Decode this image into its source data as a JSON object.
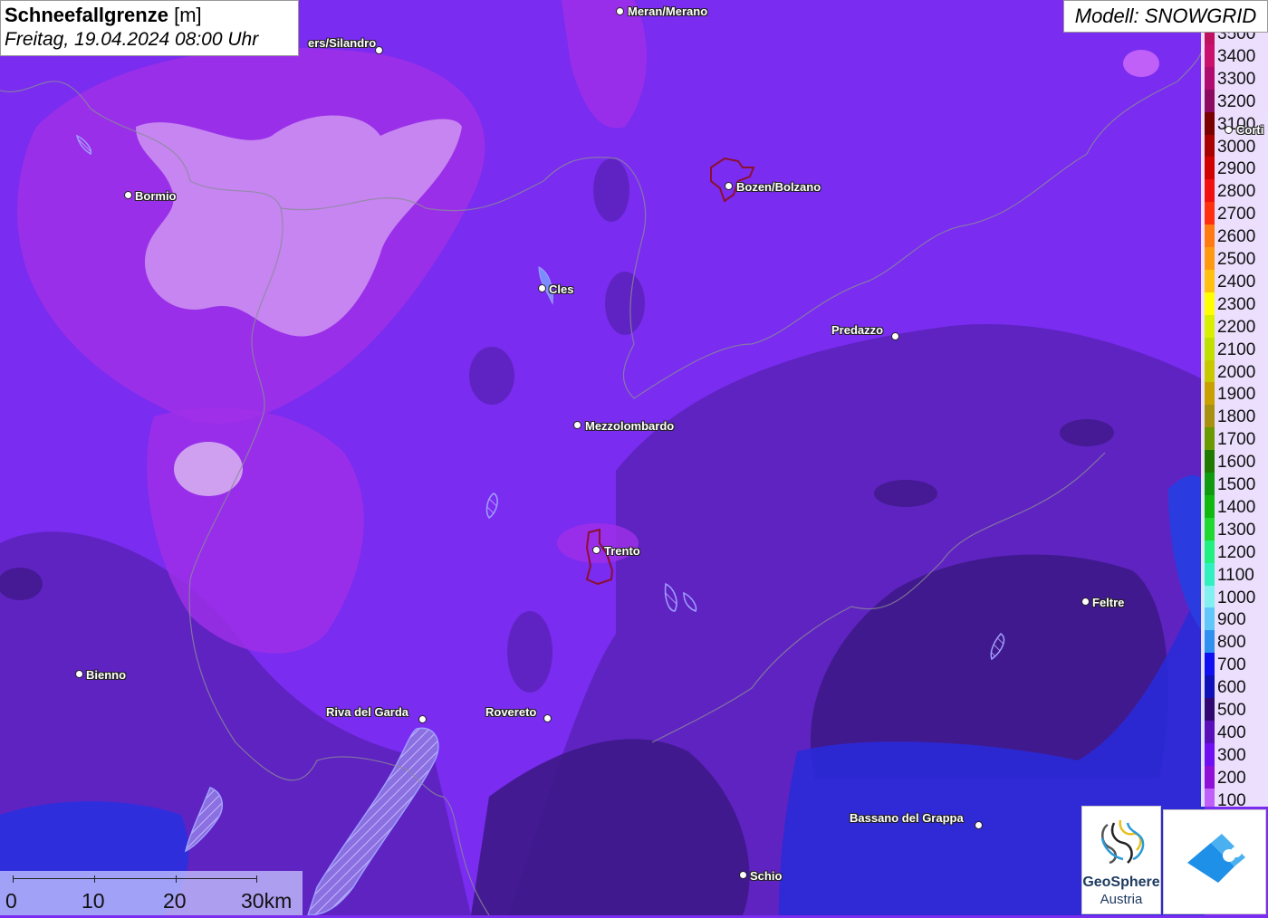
{
  "header": {
    "title": "Schneefallgrenze",
    "unit": "[m]",
    "datetime": "Freitag, 19.04.2024 08:00 Uhr"
  },
  "model": "Modell: SNOWGRID",
  "legend": {
    "levels": [
      {
        "label": "3500",
        "color": "#c01060"
      },
      {
        "label": "3400",
        "color": "#c8106c"
      },
      {
        "label": "3300",
        "color": "#b00c70"
      },
      {
        "label": "3200",
        "color": "#8c0a60"
      },
      {
        "label": "3100",
        "color": "#7a0000"
      },
      {
        "label": "3000",
        "color": "#a80000"
      },
      {
        "label": "2900",
        "color": "#d00000"
      },
      {
        "label": "2800",
        "color": "#f01010"
      },
      {
        "label": "2700",
        "color": "#ff3010"
      },
      {
        "label": "2600",
        "color": "#ff7a10"
      },
      {
        "label": "2500",
        "color": "#ff9a10"
      },
      {
        "label": "2400",
        "color": "#ffc010"
      },
      {
        "label": "2300",
        "color": "#ffff00"
      },
      {
        "label": "2200",
        "color": "#d8f000"
      },
      {
        "label": "2100",
        "color": "#c0e000"
      },
      {
        "label": "2000",
        "color": "#c8c800"
      },
      {
        "label": "1900",
        "color": "#c8a000"
      },
      {
        "label": "1800",
        "color": "#a89010"
      },
      {
        "label": "1700",
        "color": "#6a9a00"
      },
      {
        "label": "1600",
        "color": "#207a00"
      },
      {
        "label": "1500",
        "color": "#109a10"
      },
      {
        "label": "1400",
        "color": "#10b810"
      },
      {
        "label": "1300",
        "color": "#20d830"
      },
      {
        "label": "1200",
        "color": "#20f080"
      },
      {
        "label": "1100",
        "color": "#30f0c0"
      },
      {
        "label": "1000",
        "color": "#80f0f0"
      },
      {
        "label": "900",
        "color": "#60c8f8"
      },
      {
        "label": "800",
        "color": "#3090f0"
      },
      {
        "label": "700",
        "color": "#1010f0"
      },
      {
        "label": "600",
        "color": "#1010b8"
      },
      {
        "label": "500",
        "color": "#300870"
      },
      {
        "label": "400",
        "color": "#5a10b8"
      },
      {
        "label": "300",
        "color": "#7010f0"
      },
      {
        "label": "200",
        "color": "#9010d8"
      },
      {
        "label": "100",
        "color": "#c060f8"
      }
    ]
  },
  "places": [
    {
      "name": "Meran/Merano"
    },
    {
      "name": "ers/Silandro"
    },
    {
      "name": "Bormio"
    },
    {
      "name": "Bozen/Bolzano"
    },
    {
      "name": "Cles"
    },
    {
      "name": "Predazzo"
    },
    {
      "name": "Mezzolombardo"
    },
    {
      "name": "Trento"
    },
    {
      "name": "Feltre"
    },
    {
      "name": "Bienno"
    },
    {
      "name": "Riva del Garda"
    },
    {
      "name": "Rovereto"
    },
    {
      "name": "Bassano del Grappa"
    },
    {
      "name": "Schio"
    },
    {
      "name": "Corti"
    }
  ],
  "scale": {
    "labels": [
      "0",
      "10",
      "20",
      "30km"
    ]
  },
  "logos": {
    "geosphere_line1": "GeoSphere",
    "geosphere_line2": "Austria"
  }
}
